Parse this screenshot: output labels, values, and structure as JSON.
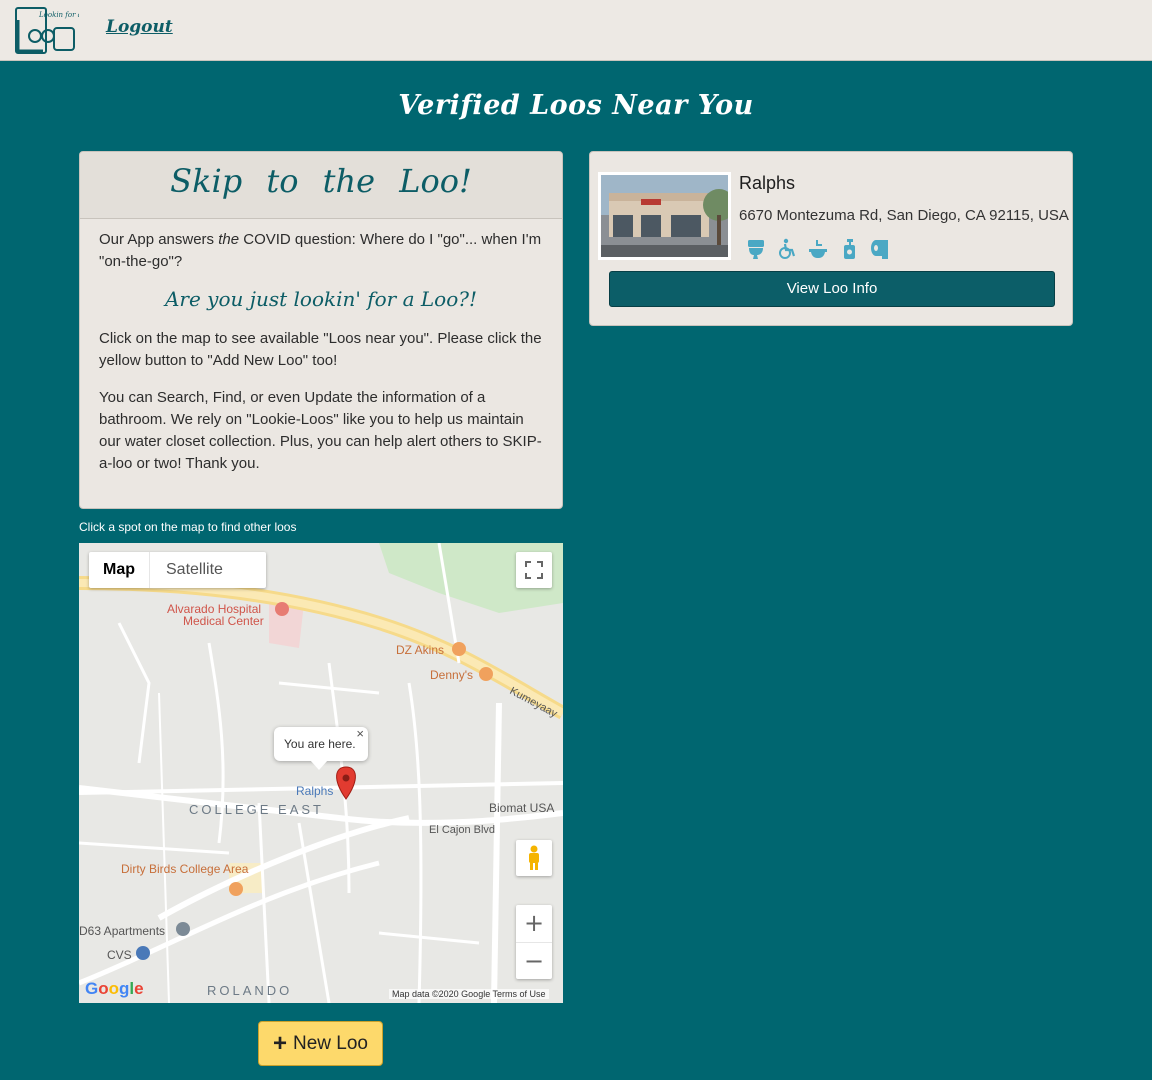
{
  "nav": {
    "logo_alt": "Lookin for a Loo logo",
    "logout_label": "Logout"
  },
  "page": {
    "title": "Verified Loos Near You"
  },
  "info_card": {
    "title": "Skip to the Loo!",
    "intro_before": "Our App answers ",
    "intro_em": "the",
    "intro_after": " COVID question: Where do I \"go\"... when I'm \"on-the-go\"?",
    "subtitle": "Are you just lookin' for a Loo?!",
    "para2": "Click on the map to see available \"Loos near you\".   Please click the yellow button to \"Add New Loo\" too!",
    "para3": "You can Search, Find, or even Update the information of a bathroom. We rely on \"Lookie-Loos\" like you to help us maintain our water closet collection. Plus, you can help alert others to SKIP-a-loo or two! Thank you."
  },
  "map": {
    "hint": "Click a spot on the map to find other loos",
    "type_map": "Map",
    "type_satellite": "Satellite",
    "info_window": "You are here.",
    "footer": "Map data ©2020 Google   Terms of Use",
    "google": "Google",
    "labels": {
      "hospital": "Alvarado Hospital Medical Center",
      "dz_akins": "DZ Akins",
      "dennys": "Denny's",
      "college_east": "COLLEGE EAST",
      "ralphs": "Ralphs",
      "biomat": "Biomat USA",
      "el_cajon_blvd": "El Cajon Blvd",
      "dirty_birds": "Dirty Birds College Area",
      "d63": "D63 Apartments",
      "cvs": "CVS",
      "rolando": "ROLANDO",
      "kumeyaay": "Kumeyaay"
    }
  },
  "new_loo": {
    "label": "New Loo"
  },
  "loo": {
    "name": "Ralphs",
    "address": "6670 Montezuma Rd, San Diego, CA 92115, USA",
    "amenity_icons": [
      "toilet-icon",
      "wheelchair-icon",
      "sink-icon",
      "soap-icon",
      "toilet-paper-icon"
    ],
    "view_label": "View Loo Info"
  },
  "colors": {
    "background": "#006670",
    "accent": "#0c5e68",
    "amenity": "#4aa8c4",
    "new_loo": "#fdd96b"
  }
}
